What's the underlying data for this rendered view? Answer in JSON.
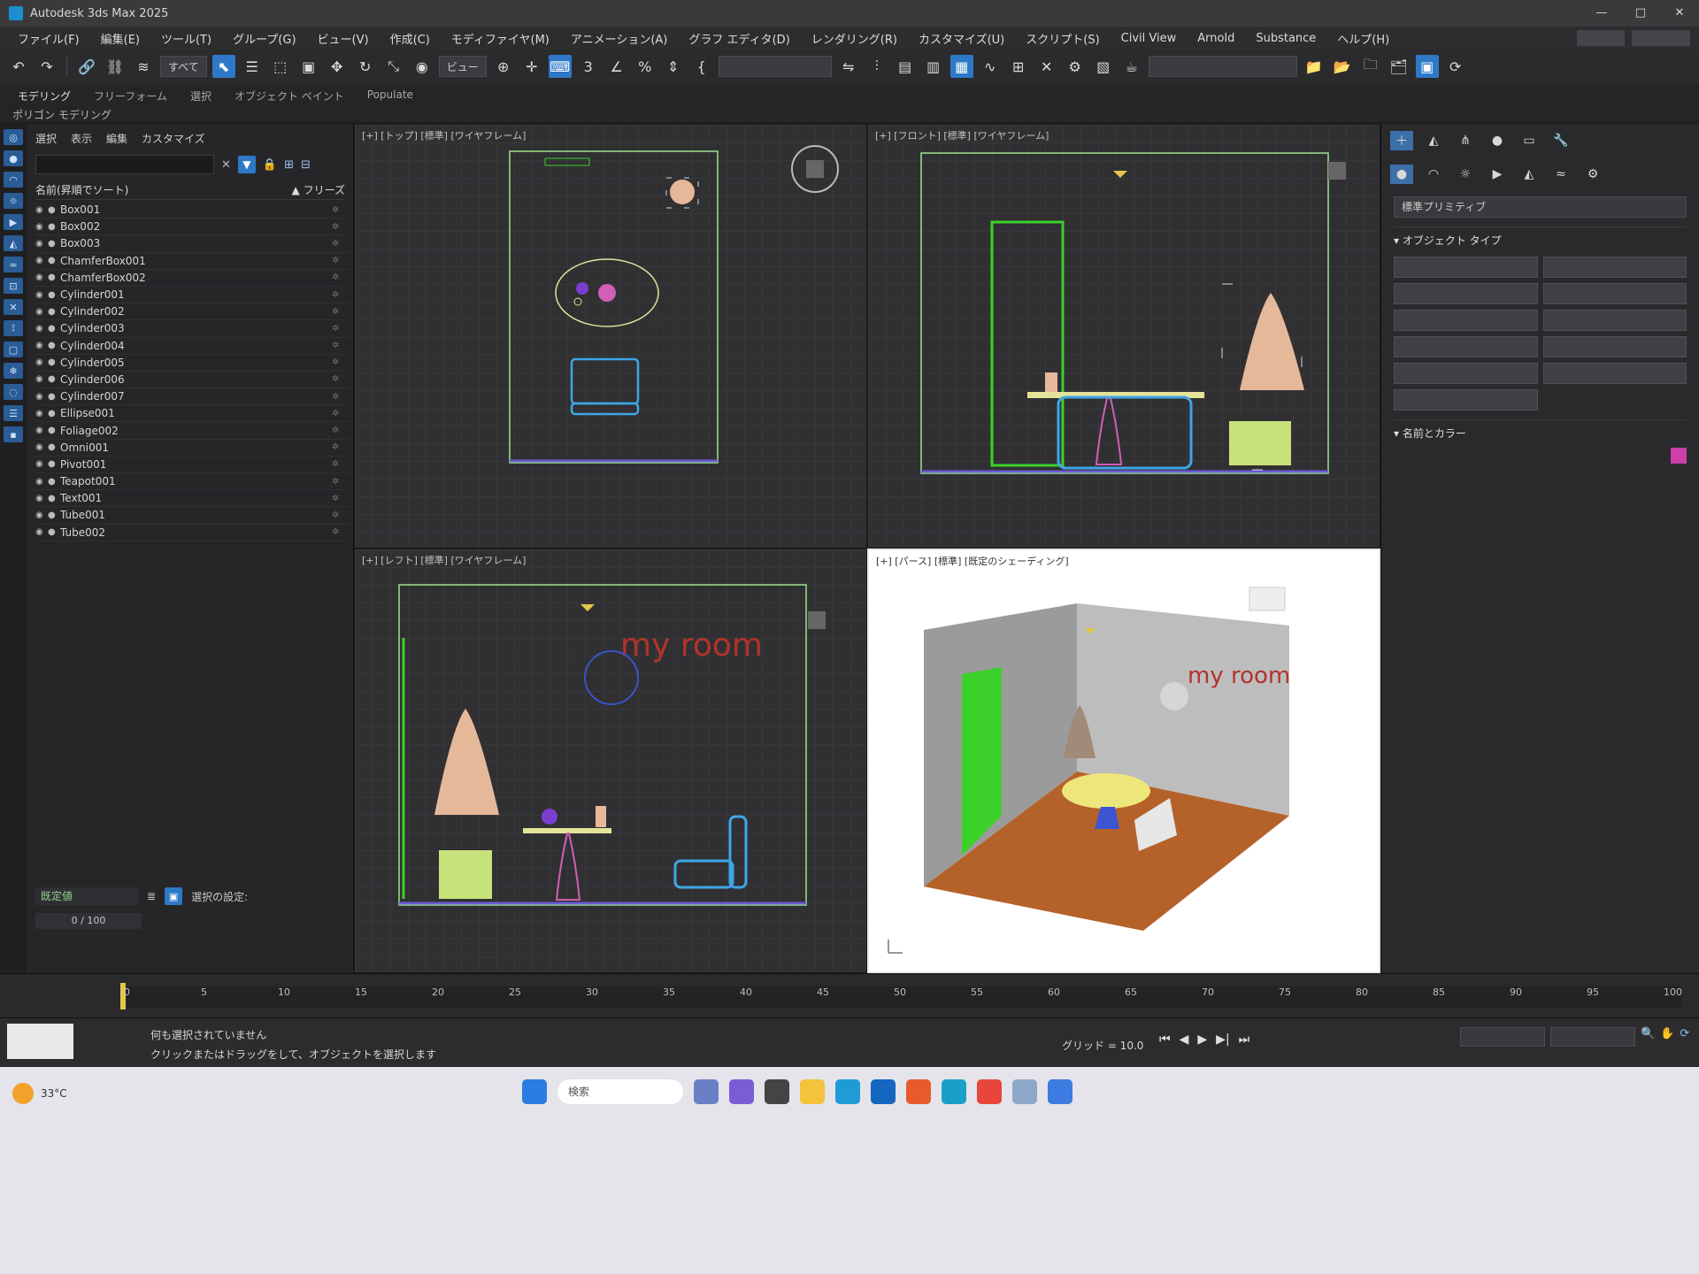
{
  "window": {
    "title": "Autodesk 3ds Max 2025",
    "controls": [
      "—",
      "□",
      "✕"
    ]
  },
  "menu": [
    "ファイル(F)",
    "編集(E)",
    "ツール(T)",
    "グループ(G)",
    "ビュー(V)",
    "作成(C)",
    "モディファイヤ(M)",
    "アニメーション(A)",
    "グラフ エディタ(D)",
    "レンダリング(R)",
    "カスタマイズ(U)",
    "スクリプト(S)",
    "Civil View",
    "Arnold",
    "Substance",
    "ヘルプ(H)"
  ],
  "toolbar": {
    "filter_value": "すべて",
    "view_value": "ビュー"
  },
  "ribbon": {
    "tabs": [
      "モデリング",
      "フリーフォーム",
      "選択",
      "オブジェクト ペイント",
      "Populate"
    ],
    "subtitle": "ポリゴン モデリング"
  },
  "explorer": {
    "menu": [
      "選択",
      "表示",
      "編集",
      "カスタマイズ"
    ],
    "col_name": "名前(昇順でソート)",
    "col_freeze": "▲ フリーズ",
    "objects": [
      "Box001",
      "Box002",
      "Box003",
      "ChamferBox001",
      "ChamferBox002",
      "Cylinder001",
      "Cylinder002",
      "Cylinder003",
      "Cylinder004",
      "Cylinder005",
      "Cylinder006",
      "Cylinder007",
      "Ellipse001",
      "Foliage002",
      "Omni001",
      "Pivot001",
      "Teapot001",
      "Text001",
      "Tube001",
      "Tube002"
    ],
    "footer_field": "既定値",
    "footer_label": "選択の設定:",
    "frames": "0 / 100"
  },
  "viewports": {
    "top_left_label": "[+] [トップ] [標準] [ワイヤフレーム]",
    "top_right_label": "[+] [フロント] [標準] [ワイヤフレーム]",
    "bottom_left_label": "[+] [レフト] [標準] [ワイヤフレーム]",
    "bottom_right_label": "[+] [パース] [標準] [既定のシェーディング]",
    "room_text": "my room"
  },
  "command_panel": {
    "dropdown": "標準プリミティブ",
    "rollout_object_type": "▾ オブジェクト タイプ",
    "rollout_name_color": "▾ 名前とカラー"
  },
  "timeline": {
    "ticks": [
      "0",
      "5",
      "10",
      "15",
      "20",
      "25",
      "30",
      "35",
      "40",
      "45",
      "50",
      "55",
      "60",
      "65",
      "70",
      "75",
      "80",
      "85",
      "90",
      "95",
      "100"
    ]
  },
  "status": {
    "line1": "何も選択されていません",
    "line2": "クリックまたはドラッグをして、オブジェクトを選択します",
    "grid": "グリッド = 10.0"
  },
  "taskbar": {
    "temp": "33°C",
    "search": "検索"
  },
  "colors": {
    "accent": "#2d79c7",
    "door_green": "#3cd12a",
    "tree": "#e6b89a",
    "sofa_blue": "#3ea6e6",
    "table_yellow": "#e4e39a",
    "stool_pink": "#d05fb5",
    "room_text_red": "#b3332a"
  }
}
